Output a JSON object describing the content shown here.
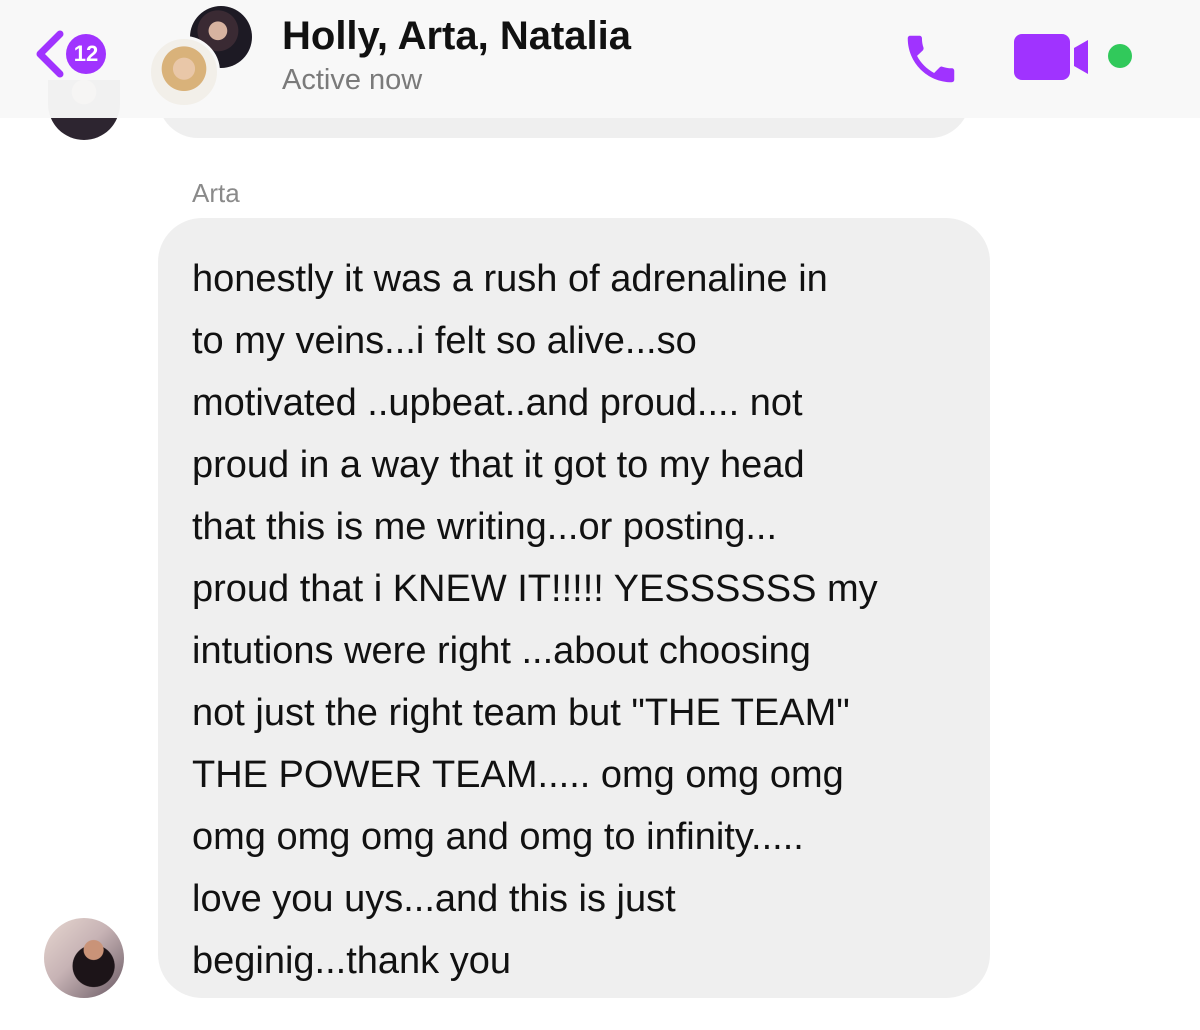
{
  "header": {
    "back_badge": "12",
    "title": "Holly, Arta, Natalia",
    "status": "Active now"
  },
  "icons": {
    "back": "chevron-left-icon",
    "call": "phone-icon",
    "video": "video-camera-icon",
    "active": "active-status-dot"
  },
  "colors": {
    "accent": "#a033ff",
    "active_green": "#31c95b",
    "bubble_gray": "#efefef",
    "status_gray": "#7a7a7a"
  },
  "message": {
    "sender": "Arta",
    "text": "honestly it was a rush of adrenaline  in\nto my veins...i felt so alive...so\nmotivated ..upbeat..and proud.... not\nproud in a way that it got to my head\nthat this is me writing...or posting...\nproud that i KNEW IT!!!!! YESSSSSS my\nintutions were right ...about choosing\nnot just the right team but \"THE TEAM\"\nTHE POWER TEAM..... omg omg omg\nomg omg omg and omg to infinity.....\nlove you uys...and this is just\nbeginig...thank  you"
  }
}
